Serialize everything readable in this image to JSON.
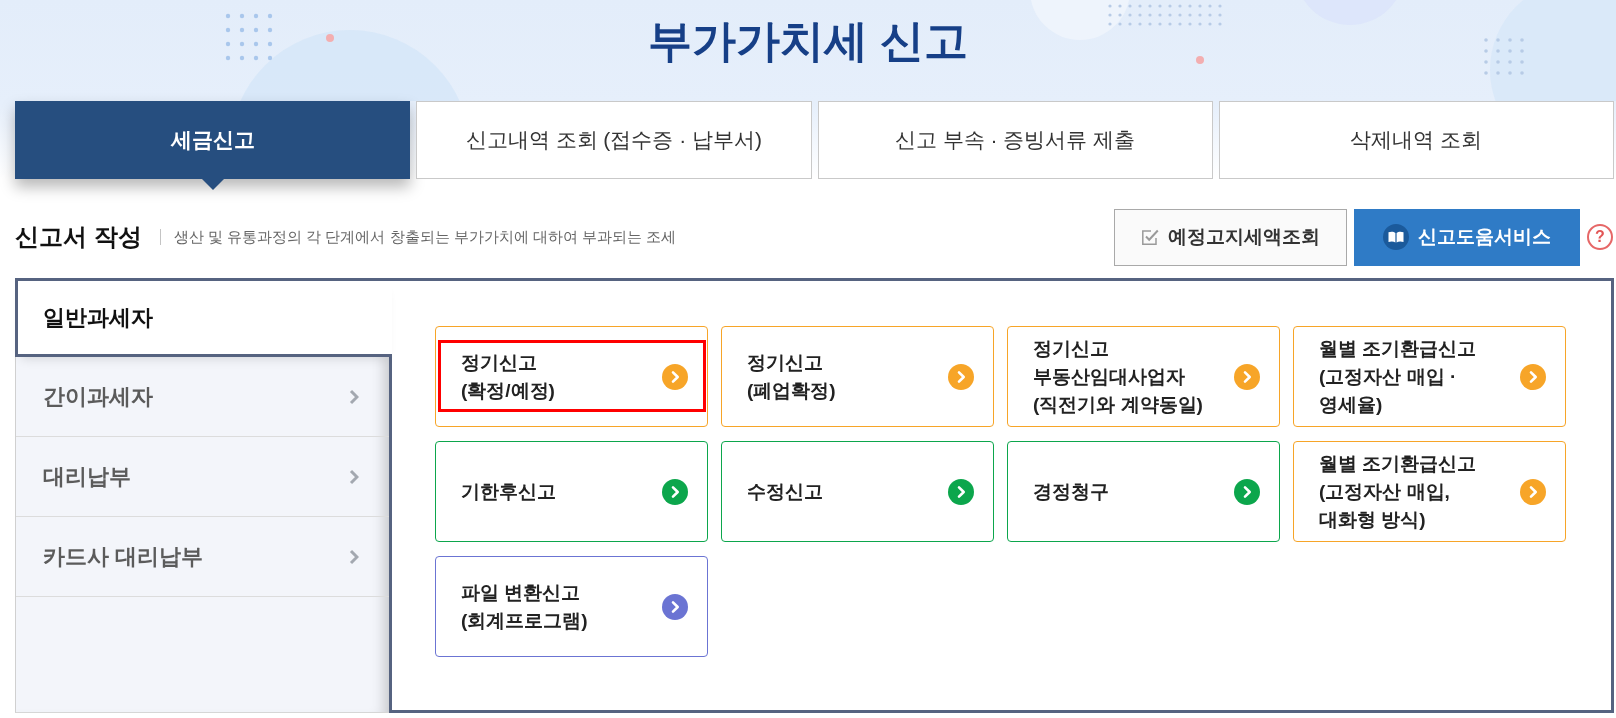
{
  "page_title": "부가가치세 신고",
  "tabs": [
    {
      "label": "세금신고",
      "selected": true
    },
    {
      "label": "신고내역 조회 (접수증 · 납부서)",
      "selected": false
    },
    {
      "label": "신고 부속 · 증빙서류 제출",
      "selected": false
    },
    {
      "label": "삭제내역 조회",
      "selected": false
    }
  ],
  "section": {
    "title": "신고서 작성",
    "description": "생산 및 유통과정의 각 단계에서 창출되는 부가가치에 대하여 부과되는 조세"
  },
  "actions": [
    {
      "kind": "outline",
      "label": "예정고지세액조회"
    },
    {
      "kind": "primary",
      "label": "신고도움서비스"
    },
    {
      "kind": "help",
      "label": "?"
    }
  ],
  "sidebar": {
    "items": [
      {
        "label": "일반과세자",
        "selected": true
      },
      {
        "label": "간이과세자",
        "selected": false
      },
      {
        "label": "대리납부",
        "selected": false
      },
      {
        "label": "카드사 대리납부",
        "selected": false
      }
    ]
  },
  "cards": [
    {
      "label": "정기신고\n(확정/예정)",
      "color": "#f7a528",
      "highlighted": true
    },
    {
      "label": "정기신고\n(폐업확정)",
      "color": "#f7a528",
      "highlighted": false
    },
    {
      "label": "정기신고\n부동산임대사업자\n(직전기와 계약동일)",
      "color": "#f7a528",
      "highlighted": false
    },
    {
      "label": "월별 조기환급신고\n(고정자산 매입 ·\n영세율)",
      "color": "#f7a528",
      "highlighted": false
    },
    {
      "label": "기한후신고",
      "color": "#0ca64c",
      "highlighted": false
    },
    {
      "label": "수정신고",
      "color": "#0ca64c",
      "highlighted": false
    },
    {
      "label": "경정청구",
      "color": "#0ca64c",
      "highlighted": false
    },
    {
      "label": "월별 조기환급신고\n(고정자산 매입,\n대화형 방식)",
      "color": "#f7a528",
      "highlighted": false
    },
    {
      "label": "파일 변환신고\n(회계프로그램)",
      "color": "#6b74d3",
      "highlighted": false
    }
  ]
}
